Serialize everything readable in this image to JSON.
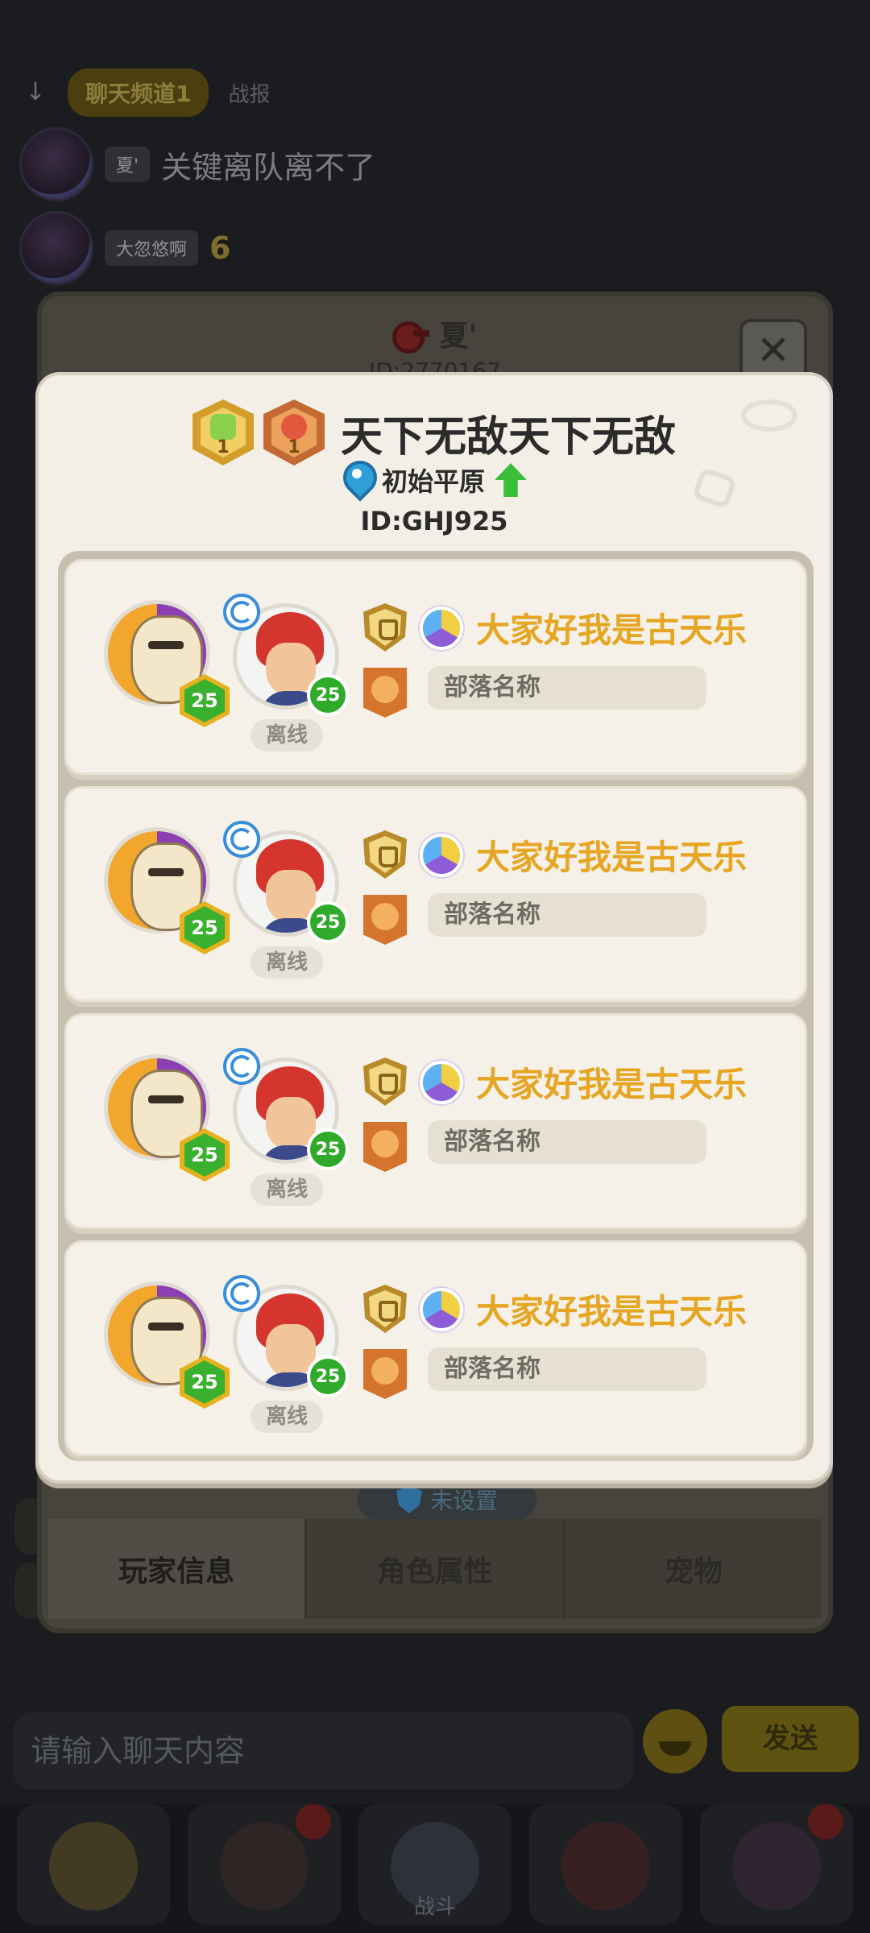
{
  "chat": {
    "tabs": [
      "聊天频道1",
      "战报"
    ],
    "messages": [
      {
        "user": "夏'",
        "text": "关键离队离不了"
      },
      {
        "user": "大忽悠啊",
        "text": "6"
      }
    ],
    "input_placeholder": "请输入聊天内容",
    "send_label": "发送"
  },
  "profile": {
    "name": "夏'",
    "id": "ID:2770167",
    "unset_label": "未设置",
    "tabs": [
      "玩家信息",
      "角色属性",
      "宠物"
    ]
  },
  "bottom_nav": {
    "battle_label": "战斗"
  },
  "modal": {
    "title": "天下无敌天下无敌",
    "rank_badges": [
      {
        "number": "1"
      },
      {
        "number": "1"
      }
    ],
    "location": "初始平原",
    "id": "ID:GHJ925",
    "members": [
      {
        "pet_level": "25",
        "hero_level": "25",
        "status": "离线",
        "name": "大家好我是古天乐",
        "tribe_placeholder": "部落名称"
      },
      {
        "pet_level": "25",
        "hero_level": "25",
        "status": "离线",
        "name": "大家好我是古天乐",
        "tribe_placeholder": "部落名称"
      },
      {
        "pet_level": "25",
        "hero_level": "25",
        "status": "离线",
        "name": "大家好我是古天乐",
        "tribe_placeholder": "部落名称"
      },
      {
        "pet_level": "25",
        "hero_level": "25",
        "status": "离线",
        "name": "大家好我是古天乐",
        "tribe_placeholder": "部落名称"
      }
    ]
  },
  "colors": {
    "player_name": "#e6a523",
    "modal_bg": "#f3efe6",
    "level_green": "#3ab02f",
    "accent_blue": "#2f9fd8"
  }
}
